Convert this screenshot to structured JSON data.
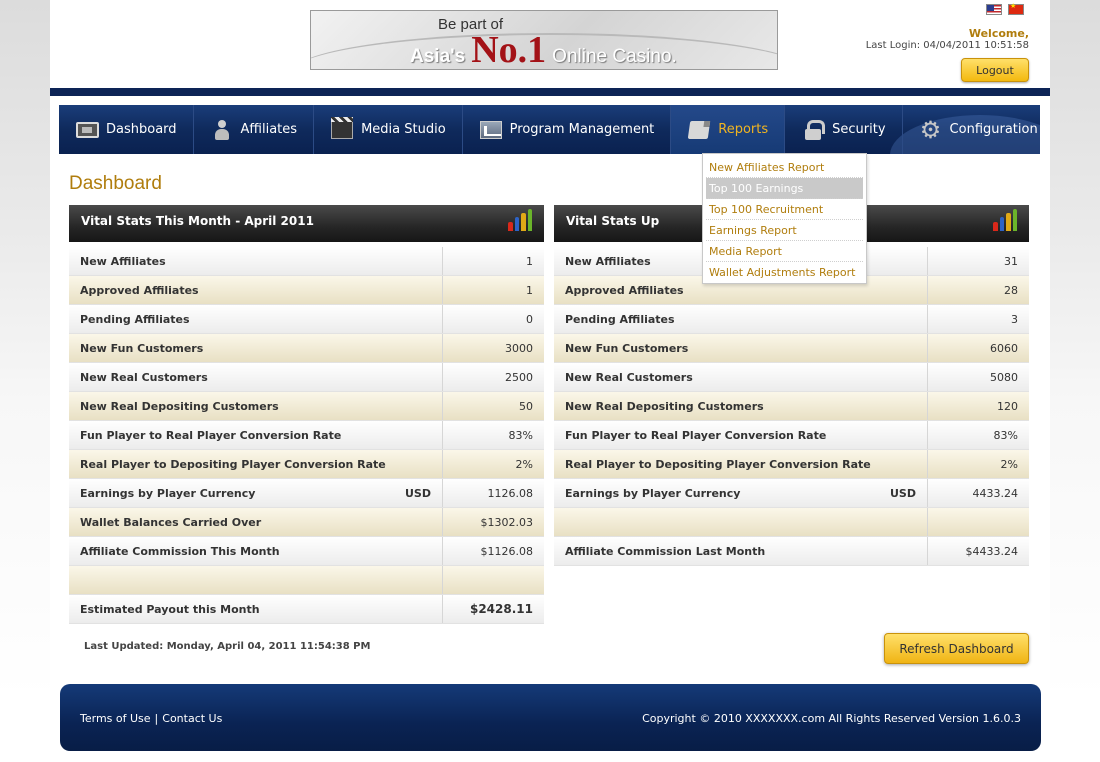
{
  "header": {
    "banner": {
      "line1": "Be part of",
      "asia": "Asia's",
      "no1": "No.1",
      "rest": "Online Casino."
    },
    "flags": [
      "flag-us",
      "flag-cn"
    ],
    "welcome": "Welcome,",
    "last_login": "Last Login: 04/04/2011 10:51:58",
    "logout_label": "Logout"
  },
  "nav": {
    "items": [
      {
        "label": "Dashboard",
        "icon": "dashboard-icon"
      },
      {
        "label": "Affiliates",
        "icon": "person-icon"
      },
      {
        "label": "Media Studio",
        "icon": "clapperboard-icon"
      },
      {
        "label": "Program Management",
        "icon": "chart-window-icon"
      },
      {
        "label": "Reports",
        "icon": "report-icon",
        "active": true
      },
      {
        "label": "Security",
        "icon": "lock-icon"
      },
      {
        "label": "Configuration",
        "icon": "gear-icon"
      }
    ],
    "reports_menu": [
      "New Affiliates Report",
      "Top 100 Earnings",
      "Top 100 Recruitment",
      "Earnings Report",
      "Media Report",
      "Wallet Adjustments Report"
    ]
  },
  "dashboard": {
    "title": "Dashboard",
    "left": {
      "heading": "Vital Stats This Month - April 2011",
      "rows": [
        {
          "label": "New Affiliates",
          "value": "1"
        },
        {
          "label": "Approved Affiliates",
          "value": "1"
        },
        {
          "label": "Pending Affiliates",
          "value": "0"
        },
        {
          "label": "New Fun Customers",
          "value": "3000"
        },
        {
          "label": "New Real Customers",
          "value": "2500"
        },
        {
          "label": "New Real Depositing Customers",
          "value": "50"
        },
        {
          "label": "Fun Player to Real Player Conversion Rate",
          "value": "83%"
        },
        {
          "label": "Real Player to Depositing Player Conversion Rate",
          "value": "2%"
        },
        {
          "label": "Earnings by Player Currency",
          "currency": "USD",
          "value": "1126.08"
        },
        {
          "label": "Wallet Balances Carried Over",
          "value": "$1302.03"
        },
        {
          "label": "Affiliate Commission This Month",
          "value": "$1126.08"
        },
        {
          "label": "",
          "value": ""
        },
        {
          "label": "Estimated Payout this Month",
          "value": "$2428.11"
        }
      ]
    },
    "right": {
      "heading": "Vital Stats Up",
      "rows": [
        {
          "label": "New Affiliates",
          "value": "31"
        },
        {
          "label": "Approved Affiliates",
          "value": "28"
        },
        {
          "label": "Pending Affiliates",
          "value": "3"
        },
        {
          "label": "New Fun Customers",
          "value": "6060"
        },
        {
          "label": "New Real Customers",
          "value": "5080"
        },
        {
          "label": "New Real Depositing Customers",
          "value": "120"
        },
        {
          "label": "Fun Player to Real Player Conversion Rate",
          "value": "83%"
        },
        {
          "label": "Real Player to Depositing Player Conversion Rate",
          "value": "2%"
        },
        {
          "label": "Earnings by Player Currency",
          "currency": "USD",
          "value": "4433.24"
        },
        {
          "label": "",
          "value": ""
        },
        {
          "label": "Affiliate Commission Last Month",
          "value": "$4433.24"
        }
      ]
    },
    "last_updated": "Last Updated: Monday, April 04, 2011 11:54:38 PM",
    "refresh_label": "Refresh Dashboard"
  },
  "footer": {
    "terms": "Terms of Use",
    "separator": "|",
    "contact": "Contact Us",
    "copyright": "Copyright © 2010 XXXXXXX.com All Rights Reserved  Version 1.6.0.3"
  },
  "colors": {
    "accent": "#b07d0d",
    "nav_bg": "#0f2a5c",
    "button": "#f3b90f"
  }
}
